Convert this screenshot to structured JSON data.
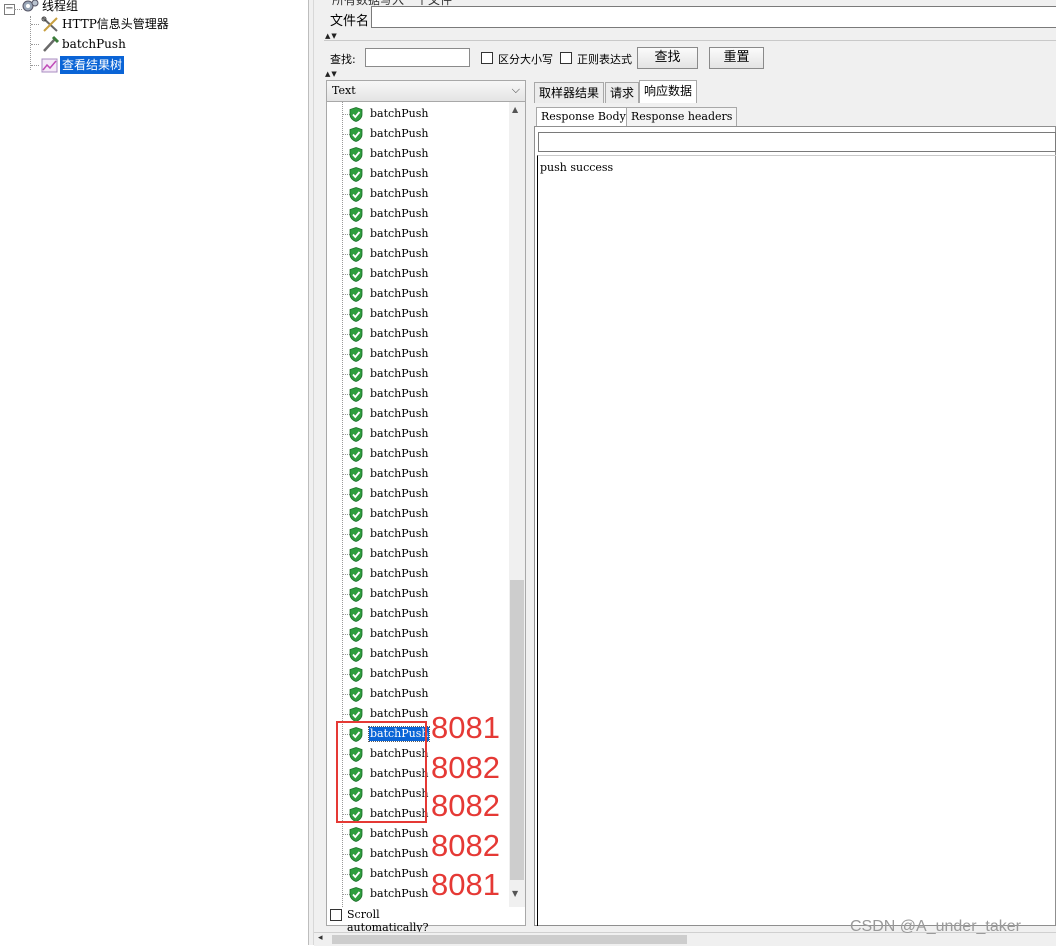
{
  "tree": {
    "root_label": "线程组",
    "children": [
      {
        "label": "HTTP信息头管理器",
        "icon": "wrench-scissors-icon"
      },
      {
        "label": "batchPush",
        "icon": "pipette-icon"
      },
      {
        "label": "查看结果树",
        "icon": "chart-icon",
        "selected": true
      }
    ]
  },
  "file": {
    "cutoff_label": "所有数据写入一个文件",
    "filename_label": "文件名",
    "filename_value": ""
  },
  "search": {
    "label": "查找:",
    "value": "",
    "case_sensitive_label": "区分大小写",
    "regex_label": "正则表达式",
    "find_button": "查找",
    "reset_button": "重置"
  },
  "results": {
    "renderer": "Text",
    "items": [
      "batchPush",
      "batchPush",
      "batchPush",
      "batchPush",
      "batchPush",
      "batchPush",
      "batchPush",
      "batchPush",
      "batchPush",
      "batchPush",
      "batchPush",
      "batchPush",
      "batchPush",
      "batchPush",
      "batchPush",
      "batchPush",
      "batchPush",
      "batchPush",
      "batchPush",
      "batchPush",
      "batchPush",
      "batchPush",
      "batchPush",
      "batchPush",
      "batchPush",
      "batchPush",
      "batchPush",
      "batchPush",
      "batchPush",
      "batchPush",
      "batchPush",
      "batchPush",
      "batchPush",
      "batchPush",
      "batchPush",
      "batchPush",
      "batchPush",
      "batchPush",
      "batchPush",
      "batchPush"
    ],
    "selected_index": 31,
    "scroll_auto_label": "Scroll automatically?"
  },
  "detail": {
    "tabs": [
      "取样器结果",
      "请求",
      "响应数据"
    ],
    "active_tab": 2,
    "subtabs": [
      "Response Body",
      "Response headers"
    ],
    "active_subtab": 0,
    "body_text": "push success"
  },
  "annotations": [
    "8081",
    "8082",
    "8082",
    "8082",
    "8081"
  ],
  "watermark": "CSDN @A_under_taker",
  "colors": {
    "selection": "#0a64d6",
    "annotation_red": "#e53935",
    "shield_green": "#2e9e3e"
  }
}
